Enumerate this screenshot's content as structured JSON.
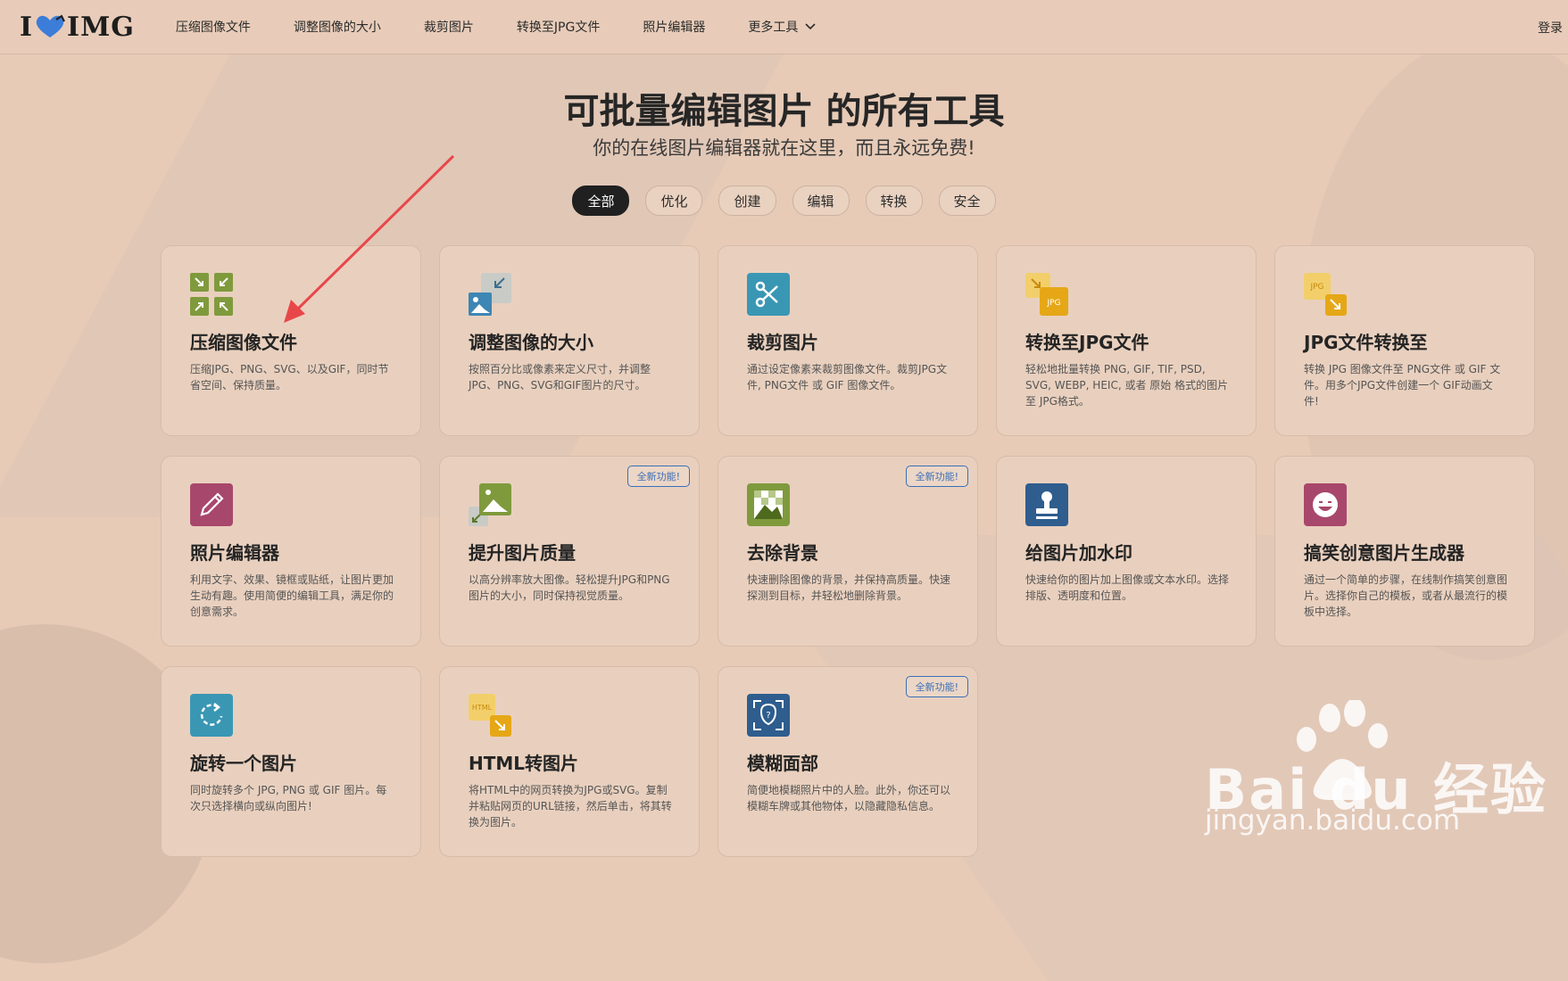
{
  "header": {
    "logo": {
      "left": "I",
      "right": "IMG"
    },
    "nav": [
      {
        "label": "压缩图像文件"
      },
      {
        "label": "调整图像的大小"
      },
      {
        "label": "裁剪图片"
      },
      {
        "label": "转换至JPG文件"
      },
      {
        "label": "照片编辑器"
      },
      {
        "label": "更多工具"
      }
    ],
    "login": "登录"
  },
  "hero": {
    "title": "可批量编辑图片 的所有工具",
    "subtitle": "你的在线图片编辑器就在这里，而且永远免费!"
  },
  "filters": [
    "全部",
    "优化",
    "创建",
    "编辑",
    "转换",
    "安全"
  ],
  "active_filter": "全部",
  "badge_label": "全新功能!",
  "tools": [
    {
      "title": "压缩图像文件",
      "desc": "压缩JPG、PNG、SVG、以及GIF，同时节省空间、保持质量。",
      "icon": "compress-icon"
    },
    {
      "title": "调整图像的大小",
      "desc": "按照百分比或像素来定义尺寸，并调整JPG、PNG、SVG和GIF图片的尺寸。",
      "icon": "resize-icon"
    },
    {
      "title": "裁剪图片",
      "desc": "通过设定像素来裁剪图像文件。裁剪JPG文件, PNG文件 或 GIF 图像文件。",
      "icon": "crop-icon"
    },
    {
      "title": "转换至JPG文件",
      "desc": "轻松地批量转换 PNG, GIF, TIF, PSD, SVG, WEBP, HEIC, 或者 原始 格式的图片至 JPG格式。",
      "icon": "convert-to-jpg-icon"
    },
    {
      "title": "JPG文件转换至",
      "desc": "转换 JPG 图像文件至 PNG文件 或 GIF 文件。用多个JPG文件创建一个 GIF动画文件!",
      "icon": "convert-from-jpg-icon"
    },
    {
      "title": "照片编辑器",
      "desc": "利用文字、效果、镜框或贴纸，让图片更加生动有趣。使用简便的编辑工具，满足你的创意需求。",
      "icon": "pencil-icon"
    },
    {
      "title": "提升图片质量",
      "desc": "以高分辨率放大图像。轻松提升JPG和PNG图片的大小，同时保持视觉质量。",
      "icon": "upscale-icon",
      "badge": true
    },
    {
      "title": "去除背景",
      "desc": "快速删除图像的背景，并保持高质量。快速探测到目标，并轻松地删除背景。",
      "icon": "remove-background-icon",
      "badge": true
    },
    {
      "title": "给图片加水印",
      "desc": "快速给你的图片加上图像或文本水印。选择排版、透明度和位置。",
      "icon": "stamp-icon"
    },
    {
      "title": "搞笑创意图片生成器",
      "desc": "通过一个简单的步骤，在线制作搞笑创意图片。选择你自己的模板，或者从最流行的模板中选择。",
      "icon": "meme-icon"
    },
    {
      "title": "旋转一个图片",
      "desc": "同时旋转多个 JPG, PNG 或 GIF 图片。每次只选择横向或纵向图片!",
      "icon": "rotate-icon"
    },
    {
      "title": "HTML转图片",
      "desc": "将HTML中的网页转换为JPG或SVG。复制并粘贴网页的URL链接，然后单击，将其转换为图片。",
      "icon": "html-to-image-icon"
    },
    {
      "title": "模糊面部",
      "desc": "简便地模糊照片中的人脸。此外，你还可以模糊车牌或其他物体，以隐藏隐私信息。",
      "icon": "blur-face-icon",
      "badge": true
    }
  ],
  "watermark": {
    "brand": "Bai du 经验",
    "url": "jingyan.baidu.com"
  },
  "colors": {
    "background": "#e7cbb7",
    "card": "#e9d0be",
    "badge": "#3a6fb8",
    "annotation_arrow": "#e8474a"
  }
}
